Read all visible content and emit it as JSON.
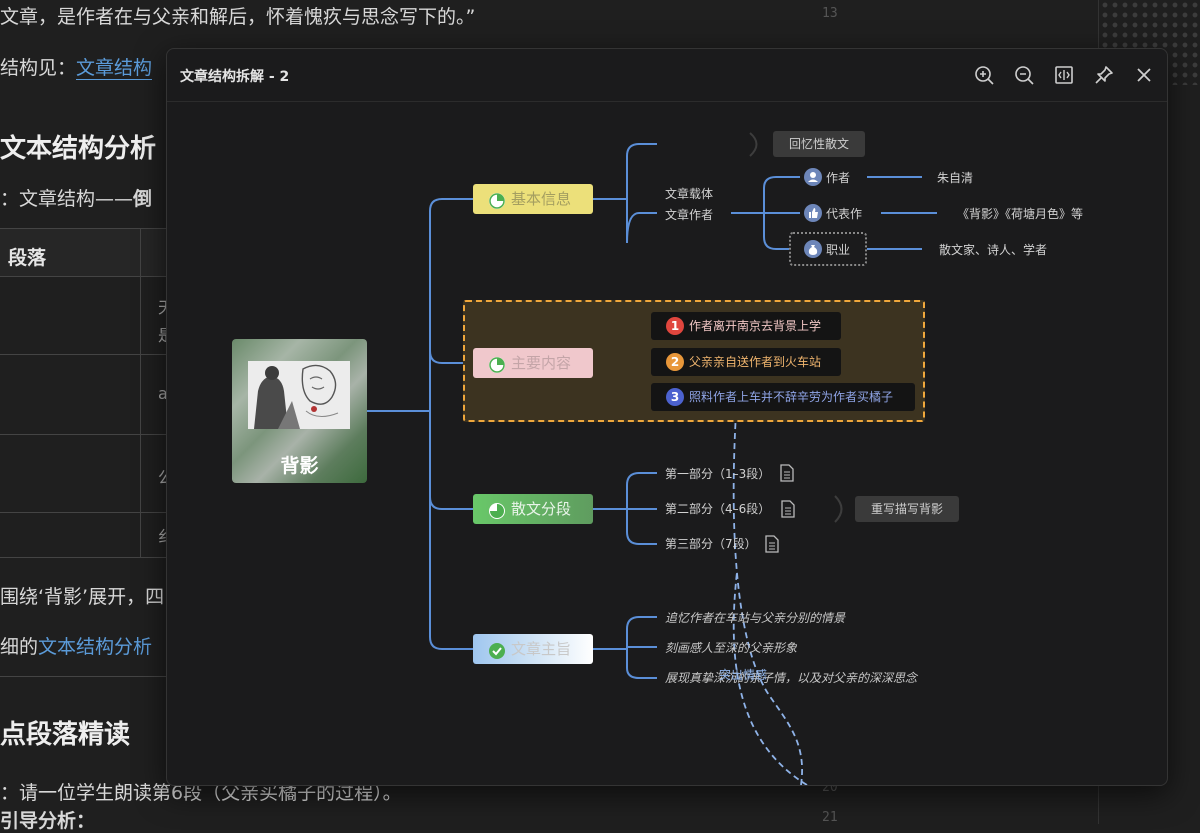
{
  "document": {
    "lines": [
      {
        "text": "文章，是作者在与父亲和解后，怀着愧疚与思念写下的。”"
      },
      {
        "prefix": "结构见：",
        "link": "文章结构"
      },
      {
        "heading": "文本结构分析"
      },
      {
        "prefix": "：文章结构——",
        "bold": "倒"
      },
      {
        "text": "围绕‘背影’展开，四"
      },
      {
        "prefix": "细的",
        "link": "文本结构分析"
      },
      {
        "heading": "点段落精读"
      },
      {
        "text": "：请一位学生朗读第6段（父亲买橘子的过程）。"
      },
      {
        "text": "引导分析："
      }
    ],
    "table_header": "段落",
    "table_fragments": [
      "天",
      "是",
      "a",
      "公",
      "纟"
    ],
    "line_numbers": [
      "13",
      "20",
      "21"
    ]
  },
  "modal": {
    "title": "文章结构拆解 - 2",
    "toolbar": {
      "zoom_in": "zoom-in",
      "zoom_out": "zoom-out",
      "fit": "fit-screen",
      "pin": "pin",
      "close": "close"
    }
  },
  "mindmap": {
    "root": {
      "label": "背影"
    },
    "branches": [
      {
        "label": "基本信息",
        "color": "#ece07a",
        "icon": "progress-quarter-icon"
      },
      {
        "label": "主要内容",
        "color": "#f0c8cc",
        "icon": "progress-quarter-icon"
      },
      {
        "label": "散文分段",
        "color": "#69c869",
        "icon": "progress-three-quarter-icon"
      },
      {
        "label": "文章主旨",
        "color": "#9fc6ef",
        "icon": "check-icon"
      }
    ],
    "basic_info": {
      "carrier_label": "文章载体",
      "carrier_value": "回忆性散文",
      "author_label": "文章作者",
      "author_items": [
        {
          "label": "作者",
          "value": "朱自清",
          "icon": "user-icon"
        },
        {
          "label": "代表作",
          "value": "《背影》《荷塘月色》等",
          "icon": "thumbs-up-icon"
        },
        {
          "label": "职业",
          "value": "散文家、诗人、学者",
          "icon": "money-bag-icon"
        }
      ]
    },
    "content_steps": [
      {
        "num": "1",
        "text": "作者离开南京去背景上学",
        "color": "#e0463e",
        "text_color": "#f0c6c4"
      },
      {
        "num": "2",
        "text": "父亲亲自送作者到火车站",
        "color": "#e8973a",
        "text_color": "#f0b56e"
      },
      {
        "num": "3",
        "text": "照料作者上车并不辞辛劳为作者买橘子",
        "color": "#4c62cf",
        "text_color": "#8fa4e6"
      }
    ],
    "sections": [
      {
        "label": "第一部分（1–3段）"
      },
      {
        "label": "第二部分（4–6段）"
      },
      {
        "label": "第三部分（7段）"
      }
    ],
    "section_note": "重写描写背影",
    "themes": [
      "追忆作者在车站与父亲分别的情景",
      "刻画感人至深的父亲形象",
      "展现真挚深沉的亲子情，以及对父亲的深深思念"
    ],
    "link_label": "突出情感",
    "colors": {
      "connector": "#5b8fd8",
      "selection": "#f0a83c"
    }
  }
}
